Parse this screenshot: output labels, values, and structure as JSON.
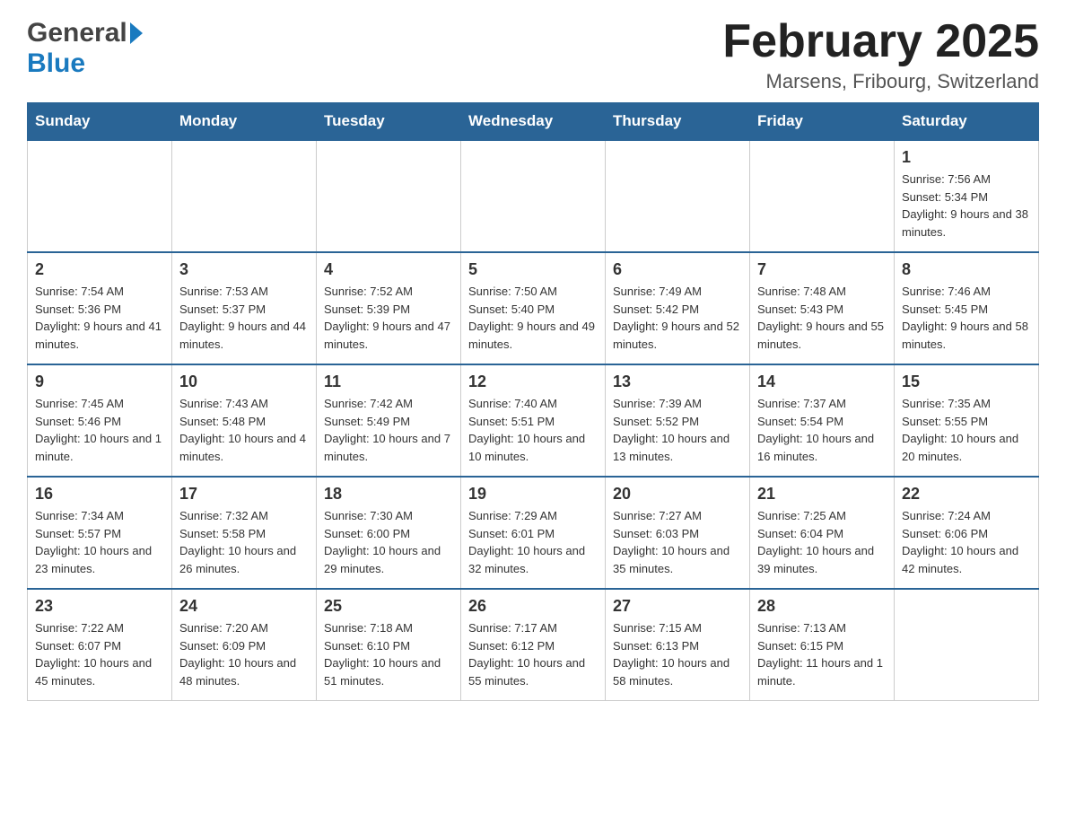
{
  "header": {
    "logo_general": "General",
    "logo_blue": "Blue",
    "month_year": "February 2025",
    "location": "Marsens, Fribourg, Switzerland"
  },
  "days_of_week": [
    "Sunday",
    "Monday",
    "Tuesday",
    "Wednesday",
    "Thursday",
    "Friday",
    "Saturday"
  ],
  "weeks": [
    {
      "days": [
        {
          "number": "",
          "info": ""
        },
        {
          "number": "",
          "info": ""
        },
        {
          "number": "",
          "info": ""
        },
        {
          "number": "",
          "info": ""
        },
        {
          "number": "",
          "info": ""
        },
        {
          "number": "",
          "info": ""
        },
        {
          "number": "1",
          "info": "Sunrise: 7:56 AM\nSunset: 5:34 PM\nDaylight: 9 hours and 38 minutes."
        }
      ]
    },
    {
      "days": [
        {
          "number": "2",
          "info": "Sunrise: 7:54 AM\nSunset: 5:36 PM\nDaylight: 9 hours and 41 minutes."
        },
        {
          "number": "3",
          "info": "Sunrise: 7:53 AM\nSunset: 5:37 PM\nDaylight: 9 hours and 44 minutes."
        },
        {
          "number": "4",
          "info": "Sunrise: 7:52 AM\nSunset: 5:39 PM\nDaylight: 9 hours and 47 minutes."
        },
        {
          "number": "5",
          "info": "Sunrise: 7:50 AM\nSunset: 5:40 PM\nDaylight: 9 hours and 49 minutes."
        },
        {
          "number": "6",
          "info": "Sunrise: 7:49 AM\nSunset: 5:42 PM\nDaylight: 9 hours and 52 minutes."
        },
        {
          "number": "7",
          "info": "Sunrise: 7:48 AM\nSunset: 5:43 PM\nDaylight: 9 hours and 55 minutes."
        },
        {
          "number": "8",
          "info": "Sunrise: 7:46 AM\nSunset: 5:45 PM\nDaylight: 9 hours and 58 minutes."
        }
      ]
    },
    {
      "days": [
        {
          "number": "9",
          "info": "Sunrise: 7:45 AM\nSunset: 5:46 PM\nDaylight: 10 hours and 1 minute."
        },
        {
          "number": "10",
          "info": "Sunrise: 7:43 AM\nSunset: 5:48 PM\nDaylight: 10 hours and 4 minutes."
        },
        {
          "number": "11",
          "info": "Sunrise: 7:42 AM\nSunset: 5:49 PM\nDaylight: 10 hours and 7 minutes."
        },
        {
          "number": "12",
          "info": "Sunrise: 7:40 AM\nSunset: 5:51 PM\nDaylight: 10 hours and 10 minutes."
        },
        {
          "number": "13",
          "info": "Sunrise: 7:39 AM\nSunset: 5:52 PM\nDaylight: 10 hours and 13 minutes."
        },
        {
          "number": "14",
          "info": "Sunrise: 7:37 AM\nSunset: 5:54 PM\nDaylight: 10 hours and 16 minutes."
        },
        {
          "number": "15",
          "info": "Sunrise: 7:35 AM\nSunset: 5:55 PM\nDaylight: 10 hours and 20 minutes."
        }
      ]
    },
    {
      "days": [
        {
          "number": "16",
          "info": "Sunrise: 7:34 AM\nSunset: 5:57 PM\nDaylight: 10 hours and 23 minutes."
        },
        {
          "number": "17",
          "info": "Sunrise: 7:32 AM\nSunset: 5:58 PM\nDaylight: 10 hours and 26 minutes."
        },
        {
          "number": "18",
          "info": "Sunrise: 7:30 AM\nSunset: 6:00 PM\nDaylight: 10 hours and 29 minutes."
        },
        {
          "number": "19",
          "info": "Sunrise: 7:29 AM\nSunset: 6:01 PM\nDaylight: 10 hours and 32 minutes."
        },
        {
          "number": "20",
          "info": "Sunrise: 7:27 AM\nSunset: 6:03 PM\nDaylight: 10 hours and 35 minutes."
        },
        {
          "number": "21",
          "info": "Sunrise: 7:25 AM\nSunset: 6:04 PM\nDaylight: 10 hours and 39 minutes."
        },
        {
          "number": "22",
          "info": "Sunrise: 7:24 AM\nSunset: 6:06 PM\nDaylight: 10 hours and 42 minutes."
        }
      ]
    },
    {
      "days": [
        {
          "number": "23",
          "info": "Sunrise: 7:22 AM\nSunset: 6:07 PM\nDaylight: 10 hours and 45 minutes."
        },
        {
          "number": "24",
          "info": "Sunrise: 7:20 AM\nSunset: 6:09 PM\nDaylight: 10 hours and 48 minutes."
        },
        {
          "number": "25",
          "info": "Sunrise: 7:18 AM\nSunset: 6:10 PM\nDaylight: 10 hours and 51 minutes."
        },
        {
          "number": "26",
          "info": "Sunrise: 7:17 AM\nSunset: 6:12 PM\nDaylight: 10 hours and 55 minutes."
        },
        {
          "number": "27",
          "info": "Sunrise: 7:15 AM\nSunset: 6:13 PM\nDaylight: 10 hours and 58 minutes."
        },
        {
          "number": "28",
          "info": "Sunrise: 7:13 AM\nSunset: 6:15 PM\nDaylight: 11 hours and 1 minute."
        },
        {
          "number": "",
          "info": ""
        }
      ]
    }
  ]
}
